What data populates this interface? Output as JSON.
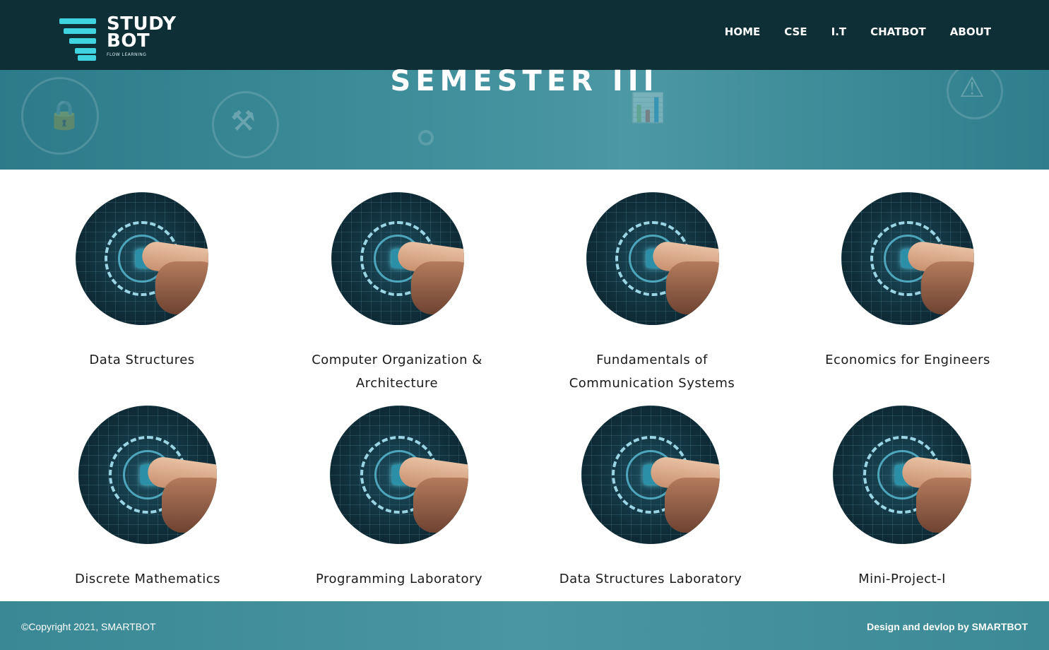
{
  "header": {
    "logo_line1": "STUDY",
    "logo_line2": "BOT",
    "logo_sub": "FLOW LEARNING",
    "nav": [
      "HOME",
      "CSE",
      "I.T",
      "CHATBOT",
      "ABOUT"
    ]
  },
  "hero": {
    "title": "SEMESTER III"
  },
  "subjects": [
    "Data Structures",
    "Computer Organization & Architecture",
    "Fundamentals of Communication Systems",
    "Economics for Engineers",
    "Discrete Mathematics",
    "Programming Laboratory",
    "Data Structures Laboratory",
    "Mini-Project-I"
  ],
  "footer": {
    "copyright": "©Copyright 2021, SMARTBOT",
    "credit": "Design and devlop by SMARTBOT"
  },
  "colors": {
    "header_bg": "#0f2f36",
    "logo_accent": "#3fd4e0",
    "hero_bg": "#3f8e9b",
    "footer_bg": "#4a96a2"
  }
}
